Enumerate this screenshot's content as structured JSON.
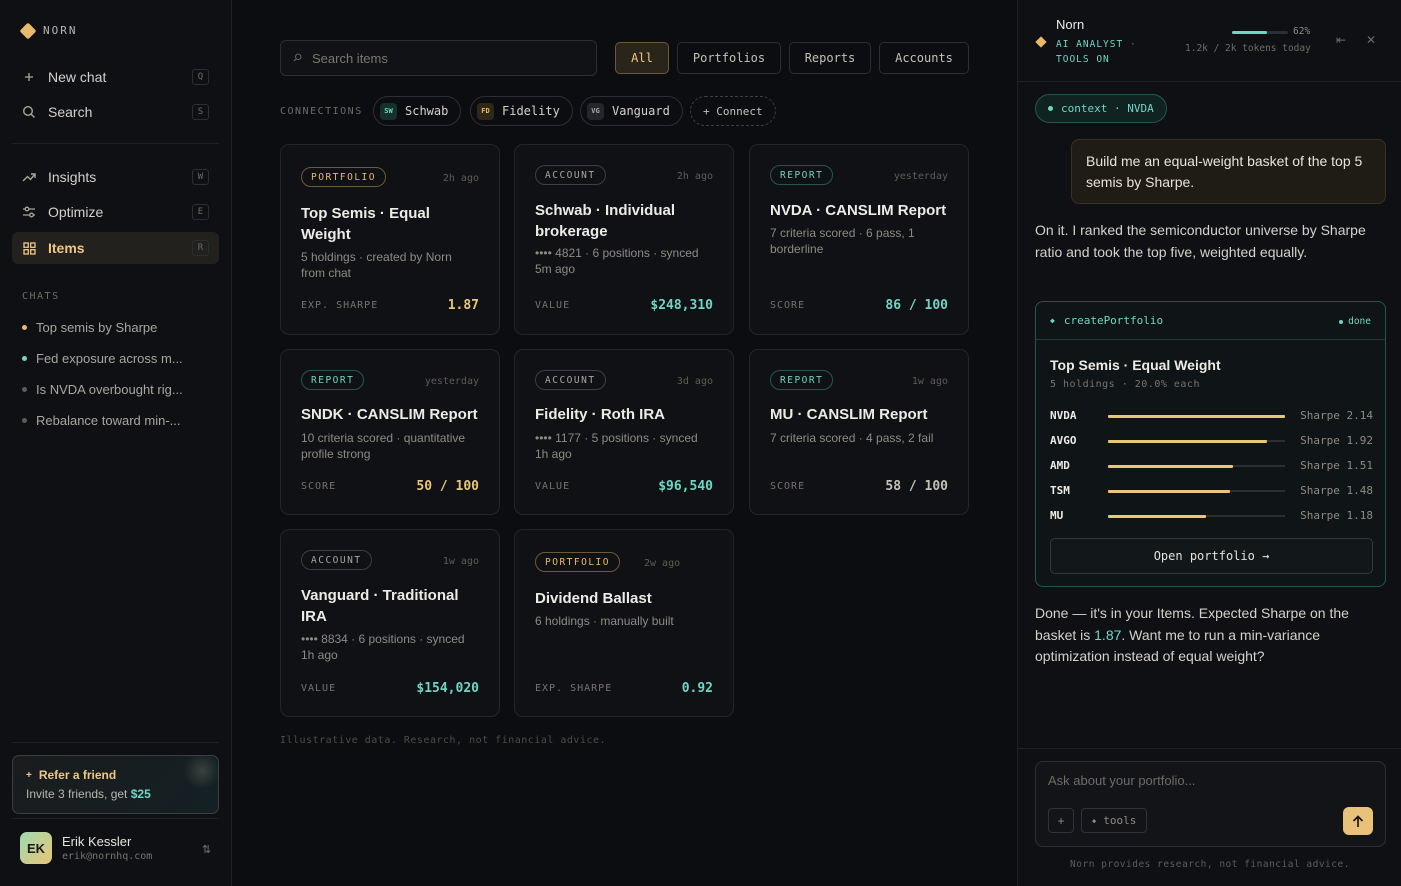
{
  "brand": {
    "name": "NORN"
  },
  "nav": [
    {
      "label": "New chat",
      "shortcut": "Q",
      "icon": "plus-icon"
    },
    {
      "label": "Search",
      "shortcut": "S",
      "icon": "search-icon"
    },
    {
      "label": "Insights",
      "shortcut": "W",
      "icon": "trend-up-icon"
    },
    {
      "label": "Optimize",
      "shortcut": "E",
      "icon": "sliders-icon"
    },
    {
      "label": "Items",
      "shortcut": "R",
      "icon": "grid-icon",
      "active": true
    }
  ],
  "chats": {
    "section_label": "CHATS",
    "items": [
      {
        "label": "Top semis by Sharpe",
        "dot_color": "#e8b96a"
      },
      {
        "label": "Fed exposure across m...",
        "dot_color": "#6fd6c4"
      },
      {
        "label": "Is NVDA overbought rig...",
        "dot_color": "#5f5c56"
      },
      {
        "label": "Rebalance toward min-...",
        "dot_color": "#5f5c56"
      }
    ]
  },
  "refer": {
    "title": "Refer a friend",
    "sub_prefix": "Invite 3 friends, get",
    "amount": "$25"
  },
  "user": {
    "initials": "EK",
    "name": "Erik Kessler",
    "email": "erik@nornhq.com"
  },
  "main": {
    "search_placeholder": "Search items",
    "filters": [
      "All",
      "Portfolios",
      "Reports",
      "Accounts"
    ],
    "active_filter": "All",
    "connections_label": "CONNECTIONS",
    "connections": [
      {
        "abbr": "SW",
        "name": "Schwab"
      },
      {
        "abbr": "FD",
        "name": "Fidelity"
      },
      {
        "abbr": "VG",
        "name": "Vanguard"
      }
    ],
    "connect_label": "+ Connect",
    "cards": [
      {
        "type": "PORTFOLIO",
        "kind": "portfolio",
        "time": "2h ago",
        "title": "Top Semis · Equal Weight",
        "sub": "5 holdings · created by Norn from chat",
        "metric_label": "EXP. SHARPE",
        "metric_value": "1.87"
      },
      {
        "type": "ACCOUNT",
        "kind": "account",
        "time": "2h ago",
        "title": "Schwab · Individual brokerage",
        "sub": "•••• 4821 · 6 positions · synced 5m ago",
        "metric_label": "VALUE",
        "metric_value": "$248,310"
      },
      {
        "type": "REPORT",
        "kind": "report",
        "time": "yesterday",
        "title": "NVDA · CANSLIM Report",
        "sub": "7 criteria scored · 6 pass, 1 borderline",
        "metric_label": "SCORE",
        "metric_value": "86 / 100"
      },
      {
        "type": "REPORT",
        "kind": "report",
        "time": "yesterday",
        "title": "SNDK · CANSLIM Report",
        "sub": "10 criteria scored · quantitative profile strong",
        "metric_label": "SCORE",
        "metric_value": "50 / 100"
      },
      {
        "type": "ACCOUNT",
        "kind": "account",
        "time": "3d ago",
        "title": "Fidelity · Roth IRA",
        "sub": "•••• 1177 · 5 positions · synced 1h ago",
        "metric_label": "VALUE",
        "metric_value": "$96,540"
      },
      {
        "type": "REPORT",
        "kind": "report",
        "time": "1w ago",
        "title": "MU · CANSLIM Report",
        "sub": "7 criteria scored · 4 pass, 2 fail",
        "metric_label": "SCORE",
        "metric_value": "58 / 100"
      },
      {
        "type": "ACCOUNT",
        "kind": "account",
        "time": "1w ago",
        "title": "Vanguard · Traditional IRA",
        "sub": "•••• 8834 · 6 positions · synced 1h ago",
        "metric_label": "VALUE",
        "metric_value": "$154,020"
      },
      {
        "type": "PORTFOLIO",
        "kind": "portfolio",
        "time": "2w ago",
        "title": "Dividend Ballast",
        "sub": "6 holdings · manually built",
        "metric_label": "EXP. SHARPE",
        "metric_value": "0.92"
      }
    ],
    "disclaimer": "Illustrative data. Research, not financial advice."
  },
  "panel": {
    "title": "Norn",
    "sub_role": "AI ANALYST",
    "sub_sep": "·",
    "sub_tools": "TOOLS ON",
    "token_pct": "62%",
    "token_fraction": 0.62,
    "token_text": "1.2k / 2k tokens today",
    "context_chip": "context · NVDA",
    "user_message": "Build me an equal-weight basket of the top 5 semis by Sharpe.",
    "ai_message_1": "On it. I ranked the semiconductor universe by Sharpe ratio and took the top five, weighted equally.",
    "tool": {
      "name": "createPortfolio",
      "status": "done",
      "title": "Top Semis · Equal Weight",
      "sub": "5 holdings · 20.0% each",
      "holdings": [
        {
          "ticker": "NVDA",
          "sharpe": 2.14,
          "label": "Sharpe 2.14"
        },
        {
          "ticker": "AVGO",
          "sharpe": 1.92,
          "label": "Sharpe 1.92"
        },
        {
          "ticker": "AMD",
          "sharpe": 1.51,
          "label": "Sharpe 1.51"
        },
        {
          "ticker": "TSM",
          "sharpe": 1.48,
          "label": "Sharpe 1.48"
        },
        {
          "ticker": "MU",
          "sharpe": 1.18,
          "label": "Sharpe 1.18"
        }
      ],
      "button": "Open portfolio →"
    },
    "ai_message_2_prefix": "Done — it's in your Items. Expected Sharpe on the basket is",
    "ai_message_2_value": "1.87",
    "ai_message_2_suffix": ". Want me to run a min-variance optimization instead of equal weight?",
    "composer_placeholder": "Ask about your portfolio...",
    "composer_tools": "tools",
    "footer": "Norn provides research, not financial advice."
  },
  "colors": {
    "accent": "#e8b96a",
    "teal": "#6fd6c4",
    "background": "#0b0d10"
  }
}
